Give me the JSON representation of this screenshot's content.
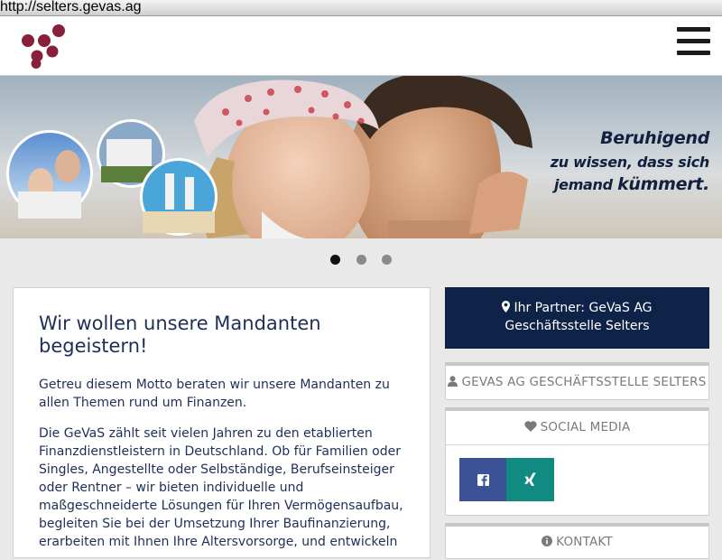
{
  "browser": {
    "url": "http://selters.gevas.ag"
  },
  "header": {
    "logo_icon": "grape-logo-icon",
    "menu_icon": "hamburger-menu-icon"
  },
  "colors": {
    "navy": "#0f2349",
    "logo": "#8a1f3c",
    "facebook": "#3b5296",
    "xing": "#118a81",
    "text": "#1e2f57"
  },
  "hero": {
    "line1": "Beruhigend",
    "line2": "zu wissen, dass sich",
    "line3_prefix": "jemand ",
    "line3_bold": "kümmert.",
    "slides": [
      {
        "label": "slide-1",
        "active": true
      },
      {
        "label": "slide-2",
        "active": false
      },
      {
        "label": "slide-3",
        "active": false
      }
    ]
  },
  "main": {
    "title": "Wir wollen unsere Mandanten begeistern!",
    "paragraph1": "Getreu diesem Motto beraten wir unsere Mandanten zu allen Themen rund um Finanzen.",
    "paragraph2": "Die GeVaS zählt seit vielen Jahren zu den etablierten Finanzdienstleistern in Deutschland. Ob für Familien oder Singles, Angestellte oder Selbständige, Berufseinsteiger oder Rentner – wir bieten individuelle und maßgeschneiderte Lösungen für Ihren Vermögensaufbau, begleiten Sie bei der Umsetzung Ihrer Baufinanzierung, erarbeiten mit Ihnen Ihre Altersvorsorge, und entwickeln"
  },
  "sidebar": {
    "partner": "Ihr Partner: GeVaS AG Geschäftsstelle Selters",
    "office_heading": "GEVAS AG GESCHÄFTSSTELLE SELTERS",
    "social_heading": "SOCIAL MEDIA",
    "contact_heading": "KONTAKT",
    "social_icons": [
      "facebook-icon",
      "xing-icon"
    ]
  }
}
